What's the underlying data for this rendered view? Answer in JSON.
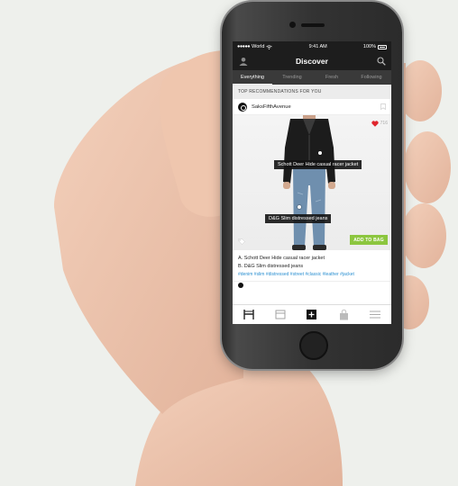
{
  "colors": {
    "statusbar_bg": "#1d1d1d",
    "tabs_bg": "#3a3a3a",
    "accent_green": "#8cc63f",
    "hashtag_blue": "#2a8fd1",
    "heart_red": "#e0262e"
  },
  "statusbar": {
    "carrier": "World",
    "time": "9:41 AM",
    "battery": "100%"
  },
  "navbar": {
    "title": "Discover",
    "left_icon": "profile-icon",
    "right_icon": "search-icon"
  },
  "tabs": [
    {
      "label": "Everything",
      "active": true
    },
    {
      "label": "Trending",
      "active": false
    },
    {
      "label": "Fresh",
      "active": false
    },
    {
      "label": "Following",
      "active": false
    }
  ],
  "feed": {
    "section_title": "TOP RECOMMENDATIONS FOR YOU",
    "post": {
      "brand": "SaksFifthAvenue",
      "likes": "716",
      "tags": [
        {
          "label": "Schott Deer Hide casual racer jacket"
        },
        {
          "label": "D&G Slim distressed jeans"
        }
      ],
      "add_to_bag": "ADD TO BAG",
      "items": [
        "A. Schott Deer Hide casual racer jacket",
        "B. D&G Slim distressed jeans"
      ],
      "hashtags": "#denim #slim #distressed #street #classic #leather #jacket"
    }
  },
  "bottom_nav": [
    {
      "icon": "home-icon",
      "active": true
    },
    {
      "icon": "closet-icon",
      "active": false
    },
    {
      "icon": "add-icon",
      "active": false
    },
    {
      "icon": "bag-icon",
      "active": false
    },
    {
      "icon": "menu-icon",
      "active": false
    }
  ]
}
